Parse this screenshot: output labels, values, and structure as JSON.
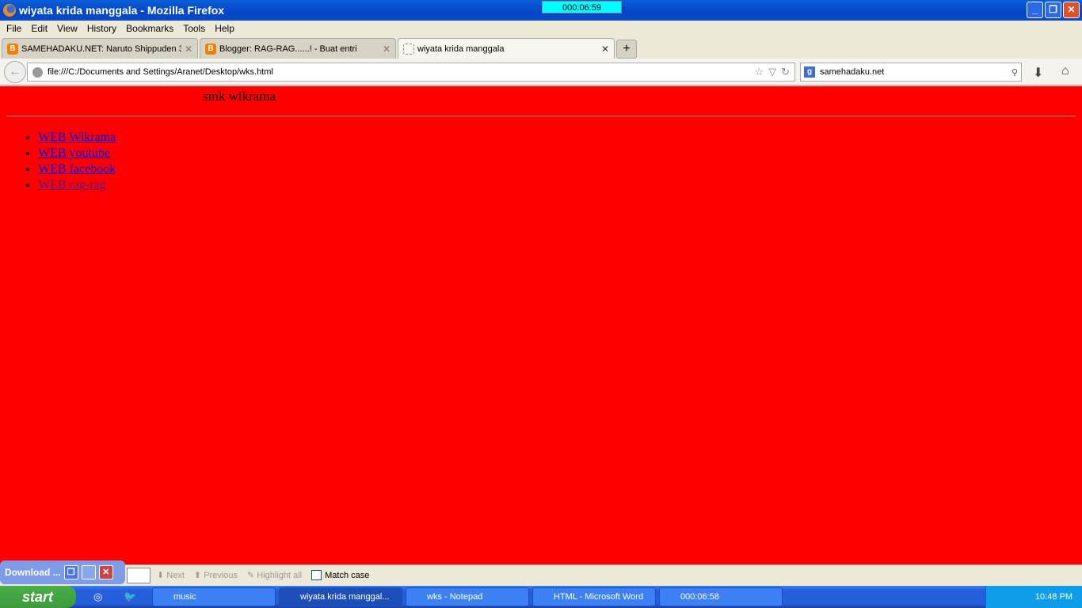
{
  "window": {
    "title": "wiyata krida manggala - Mozilla Firefox",
    "timer": "000:06:59",
    "minimize": "_",
    "restore": "❐",
    "close": "✕"
  },
  "menu": [
    "File",
    "Edit",
    "View",
    "History",
    "Bookmarks",
    "Tools",
    "Help"
  ],
  "tabs": [
    {
      "title": "SAMEHADAKU.NET: Naruto Shippuden 3...",
      "icon": "blogger-icon"
    },
    {
      "title": "Blogger: RAG-RAG......! - Buat entri",
      "icon": "blogger-icon"
    },
    {
      "title": "wiyata krida manggala",
      "icon": "blank-page-icon"
    }
  ],
  "new_tab": "+",
  "nav": {
    "url": "file:///C:/Documents and Settings/Aranet/Desktop/wks.html",
    "search": "samehadaku.net"
  },
  "page": {
    "heading": "smk wikrama",
    "background": "#ff0000",
    "links": [
      {
        "label": "WEB Wikrama",
        "visited": false
      },
      {
        "label": "WEB youtube",
        "visited": false
      },
      {
        "label": "WEB facebook",
        "visited": false
      },
      {
        "label": "WEB rag-rag",
        "visited": true
      }
    ]
  },
  "findbar": {
    "next": "Next",
    "previous": "Previous",
    "highlight": "Highlight all",
    "match_case": "Match case",
    "match_case_checked": false
  },
  "download_popup": {
    "label": "Download ..."
  },
  "taskbar": {
    "start": "start",
    "items": [
      {
        "label": "music",
        "active": false
      },
      {
        "label": "wiyata krida manggal...",
        "active": true
      },
      {
        "label": "wks - Notepad",
        "active": false
      },
      {
        "label": "HTML - Microsoft Word",
        "active": false
      },
      {
        "label": "000:06:58",
        "active": false
      }
    ],
    "clock": "10:48 PM"
  }
}
